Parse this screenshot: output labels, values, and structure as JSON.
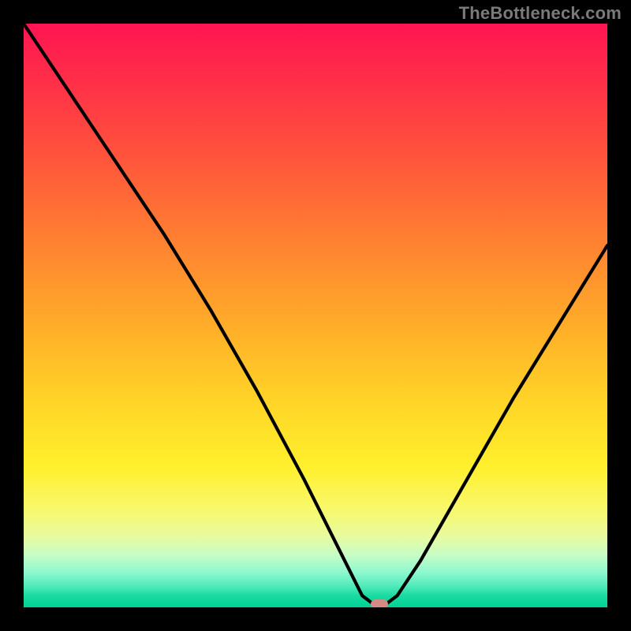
{
  "watermark": "TheBottleneck.com",
  "chart_data": {
    "type": "line",
    "title": "",
    "xlabel": "",
    "ylabel": "",
    "xlim": [
      0,
      100
    ],
    "ylim": [
      0,
      100
    ],
    "grid": false,
    "series": [
      {
        "name": "bottleneck-curve",
        "x": [
          0,
          8,
          16,
          24,
          32,
          40,
          48,
          55,
          58,
          60,
          62,
          64,
          68,
          76,
          84,
          92,
          100
        ],
        "values": [
          100,
          88,
          76,
          64,
          51,
          37,
          22,
          8,
          2,
          0.5,
          0.5,
          2,
          8,
          22,
          36,
          49,
          62
        ]
      }
    ],
    "optimum_x": 61,
    "marker_color": "#d58a84",
    "colors": {
      "gradient_top": "#ff1452",
      "gradient_bottom": "#00d192",
      "curve": "#000000",
      "frame": "#000000"
    }
  }
}
